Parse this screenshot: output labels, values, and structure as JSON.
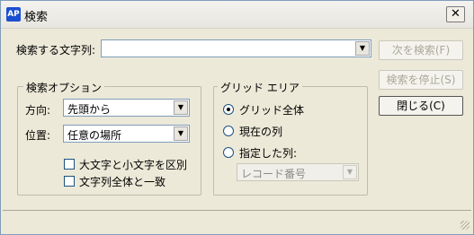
{
  "window": {
    "title": "検索",
    "app_icon_text": "AP",
    "close_glyph": "✕"
  },
  "search": {
    "label": "検索する文字列:",
    "value": ""
  },
  "buttons": {
    "find_next": "次を検索(F)",
    "stop_search": "検索を停止(S)",
    "close": "閉じる(C)"
  },
  "options": {
    "group_title": "検索オプション",
    "direction_label": "方向:",
    "direction_value": "先頭から",
    "position_label": "位置:",
    "position_value": "任意の場所",
    "match_case": {
      "label": "大文字と小文字を区別",
      "checked": false
    },
    "whole_string": {
      "label": "文字列全体と一致",
      "checked": false
    }
  },
  "grid_area": {
    "group_title": "グリッド エリア",
    "radios": [
      {
        "label": "グリッド全体",
        "selected": true
      },
      {
        "label": "現在の列",
        "selected": false
      },
      {
        "label": "指定した列:",
        "selected": false
      }
    ],
    "column_value": "レコード番号"
  }
}
